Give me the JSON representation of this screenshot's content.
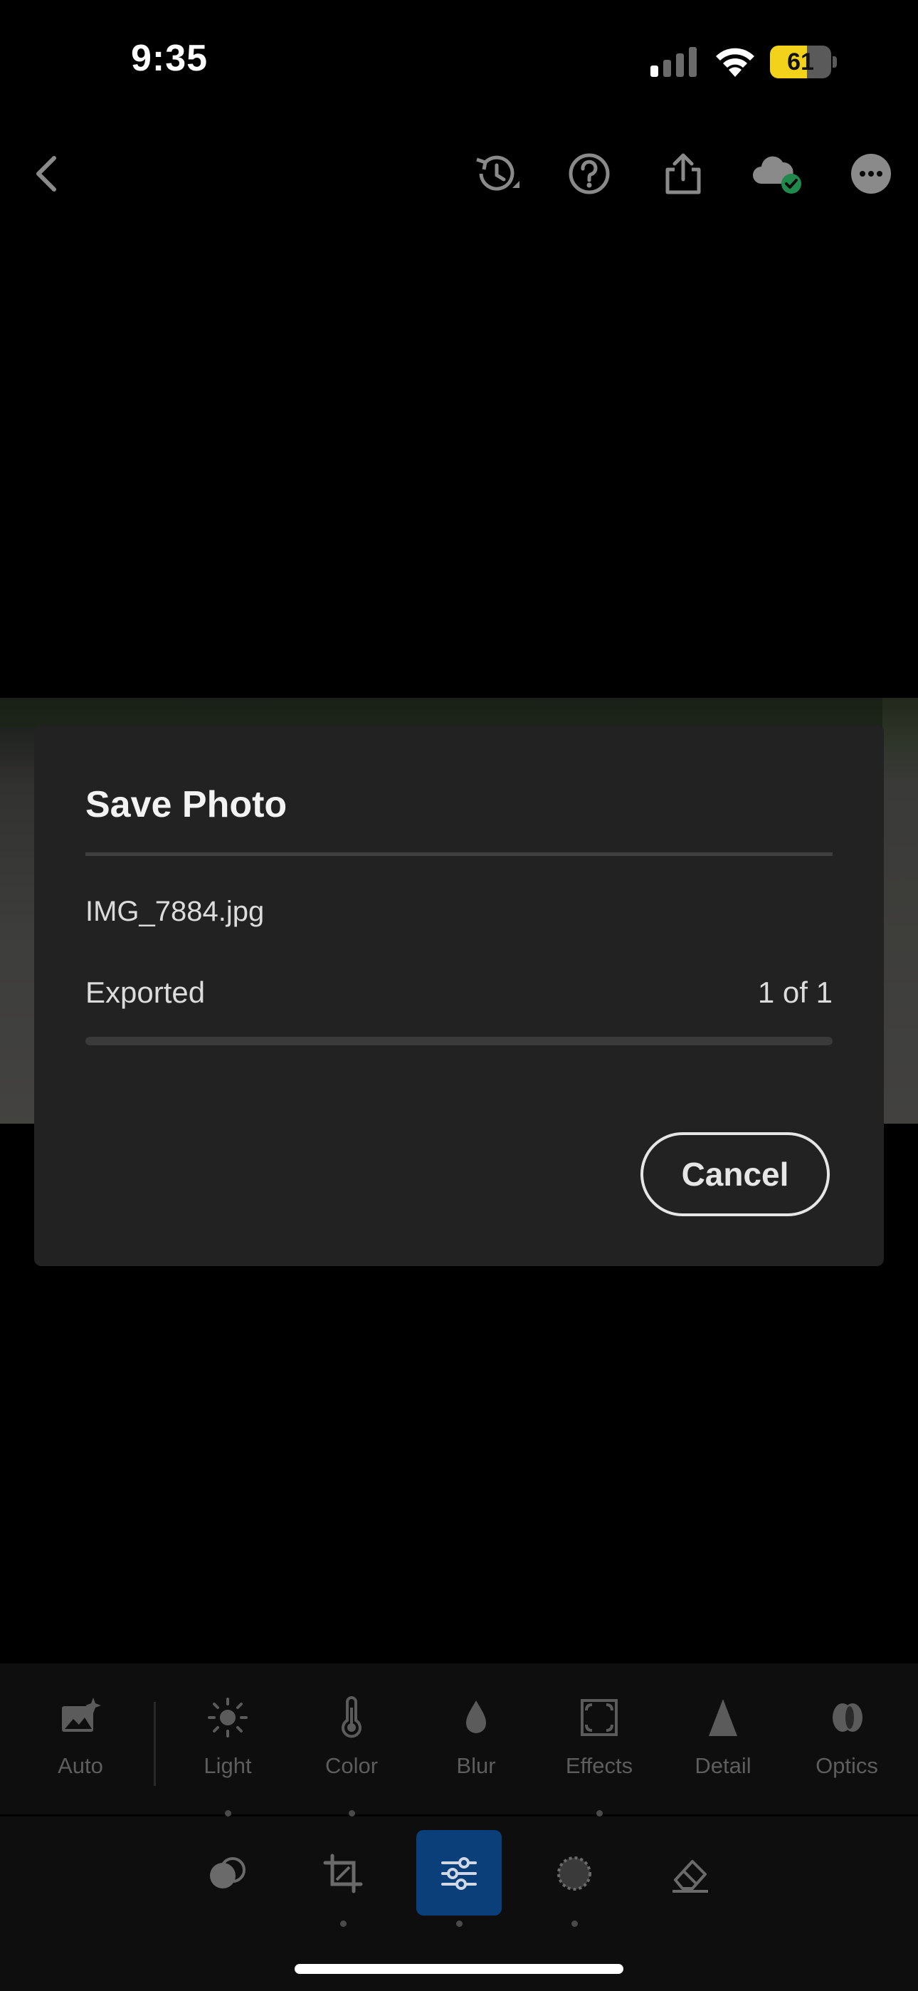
{
  "status_bar": {
    "time": "9:35",
    "battery_percent": 61
  },
  "toolbar": {
    "icons": [
      "back-chevron-icon",
      "history-icon",
      "help-icon",
      "share-icon",
      "cloud-synced-icon",
      "more-icon"
    ]
  },
  "dialog": {
    "title": "Save Photo",
    "filename": "IMG_7884.jpg",
    "status": "Exported",
    "count": "1 of 1",
    "progress": 1.0,
    "cancel_label": "Cancel"
  },
  "edit_tools": [
    {
      "label": "Auto"
    },
    {
      "label": "Light"
    },
    {
      "label": "Color"
    },
    {
      "label": "Blur"
    },
    {
      "label": "Effects"
    },
    {
      "label": "Detail"
    },
    {
      "label": "Optics"
    }
  ],
  "modes": [
    "presets-icon",
    "crop-icon",
    "adjust-icon",
    "masking-icon",
    "remove-icon"
  ],
  "colors": {
    "dialog_bg": "#222222",
    "active_mode": "#0b3f7a",
    "battery": "#f2d21b"
  }
}
